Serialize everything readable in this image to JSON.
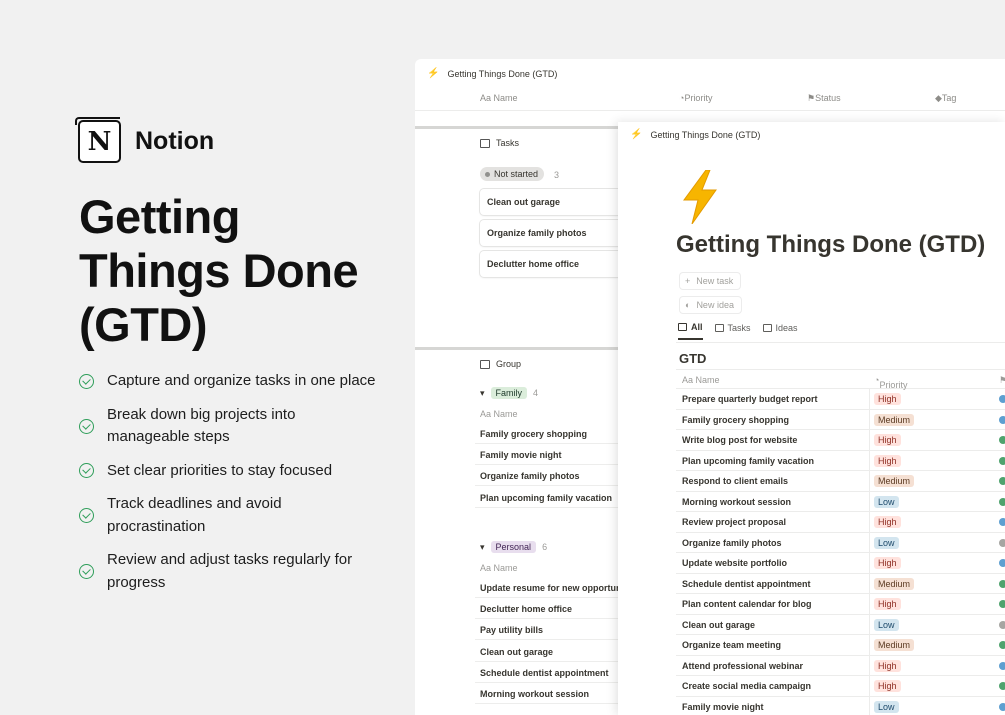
{
  "brand": {
    "name": "Notion",
    "logo_letter": "N"
  },
  "hero": {
    "title": "Getting Things Done (GTD)"
  },
  "features": [
    "Capture and organize tasks in one place",
    "Break down big projects into manageable steps",
    "Set clear priorities to stay focused",
    "Track deadlines and avoid procrastination",
    "Review and adjust tasks regularly for progress"
  ],
  "back_window": {
    "title": "Getting Things Done (GTD)",
    "columns": {
      "name": "Aa Name",
      "priority": "Priority",
      "status": "Status",
      "tag": "Tag"
    },
    "board": {
      "label": "Tasks",
      "status_pill": "Not started",
      "count": "3",
      "cards": [
        "Clean out garage",
        "Organize family photos",
        "Declutter home office"
      ]
    },
    "group_view": {
      "label": "Group",
      "name_col": "Aa Name",
      "groups": [
        {
          "tag": "Family",
          "count": "4",
          "rows": [
            "Family grocery shopping",
            "Family movie night",
            "Organize family photos",
            "Plan upcoming family vacation"
          ]
        },
        {
          "tag": "Personal",
          "count": "6",
          "rows": [
            "Update resume for new opportunities",
            "Declutter home office",
            "Pay utility bills",
            "Clean out garage",
            "Schedule dentist appointment",
            "Morning workout session"
          ]
        }
      ]
    }
  },
  "front_window": {
    "breadcrumb": "Getting Things Done (GTD)",
    "page_title": "Getting Things Done (GTD)",
    "buttons": {
      "new_task": "New task",
      "new_idea": "New idea"
    },
    "tabs": [
      "All",
      "Tasks",
      "Ideas"
    ],
    "db_title": "GTD",
    "columns": {
      "name": "Aa Name",
      "priority": "Priority"
    },
    "rows": [
      {
        "name": "Prepare quarterly budget report",
        "priority": "High",
        "status_color": "#5e9fd0"
      },
      {
        "name": "Family grocery shopping",
        "priority": "Medium",
        "status_color": "#5e9fd0"
      },
      {
        "name": "Write blog post for website",
        "priority": "High",
        "status_color": "#4fa36e"
      },
      {
        "name": "Plan upcoming family vacation",
        "priority": "High",
        "status_color": "#4fa36e"
      },
      {
        "name": "Respond to client emails",
        "priority": "Medium",
        "status_color": "#4fa36e"
      },
      {
        "name": "Morning workout session",
        "priority": "Low",
        "status_color": "#4fa36e"
      },
      {
        "name": "Review project proposal",
        "priority": "High",
        "status_color": "#5e9fd0"
      },
      {
        "name": "Organize family photos",
        "priority": "Low",
        "status_color": "#a6a5a2"
      },
      {
        "name": "Update website portfolio",
        "priority": "High",
        "status_color": "#5e9fd0"
      },
      {
        "name": "Schedule dentist appointment",
        "priority": "Medium",
        "status_color": "#4fa36e"
      },
      {
        "name": "Plan content calendar for blog",
        "priority": "High",
        "status_color": "#4fa36e"
      },
      {
        "name": "Clean out garage",
        "priority": "Low",
        "status_color": "#a6a5a2"
      },
      {
        "name": "Organize team meeting",
        "priority": "Medium",
        "status_color": "#4fa36e"
      },
      {
        "name": "Attend professional webinar",
        "priority": "High",
        "status_color": "#5e9fd0"
      },
      {
        "name": "Create social media campaign",
        "priority": "High",
        "status_color": "#4fa36e"
      },
      {
        "name": "Family movie night",
        "priority": "Low",
        "status_color": "#5e9fd0"
      }
    ]
  }
}
